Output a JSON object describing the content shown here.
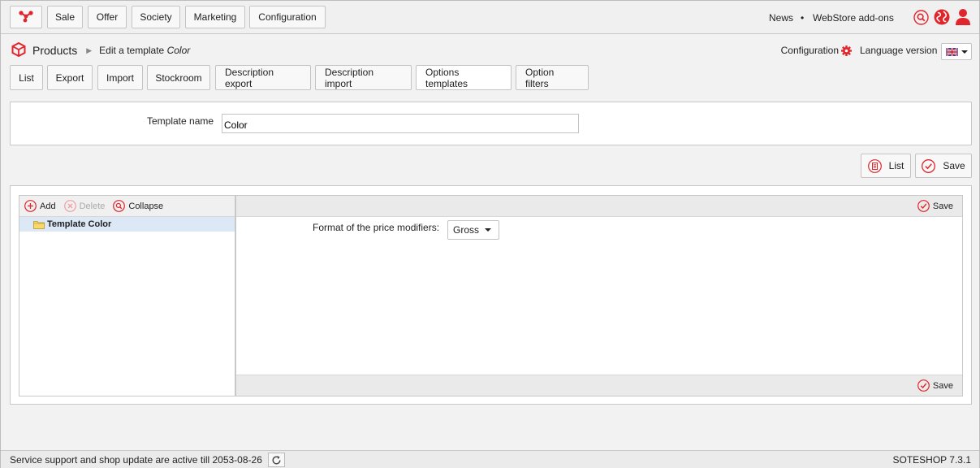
{
  "brand_color": "#e0262d",
  "nav": {
    "logo_icon": "soteshop-logo-icon",
    "items": [
      "Sale",
      "Offer",
      "Society",
      "Marketing",
      "Configuration"
    ],
    "news": "News",
    "separator": "•",
    "addons": "WebStore add-ons",
    "right_icons": [
      "search-icon",
      "globe-icon",
      "user-icon"
    ]
  },
  "breadcrumb": {
    "module": "Products",
    "page_prefix": "Edit a template",
    "page_name": "Color"
  },
  "header_right": {
    "configuration": "Configuration",
    "language_version": "Language version",
    "language_flag": "uk-flag-icon"
  },
  "tabs": {
    "items": [
      "List",
      "Export",
      "Import",
      "Stockroom",
      "Description export",
      "Description import",
      "Options templates",
      "Option filters"
    ],
    "active": "Options templates"
  },
  "form": {
    "template_name_label": "Template name",
    "template_name_value": "Color"
  },
  "actions": {
    "list": "List",
    "save": "Save"
  },
  "tree": {
    "add": "Add",
    "delete": "Delete",
    "collapse": "Collapse",
    "node": "Template Color"
  },
  "editor": {
    "save_top": "Save",
    "save_bottom": "Save",
    "format_label": "Format of the price modifiers:",
    "format_value": "Gross"
  },
  "footer": {
    "support_text": "Service support and shop update are active till 2053-08-26",
    "version": "SOTESHOP 7.3.1"
  }
}
